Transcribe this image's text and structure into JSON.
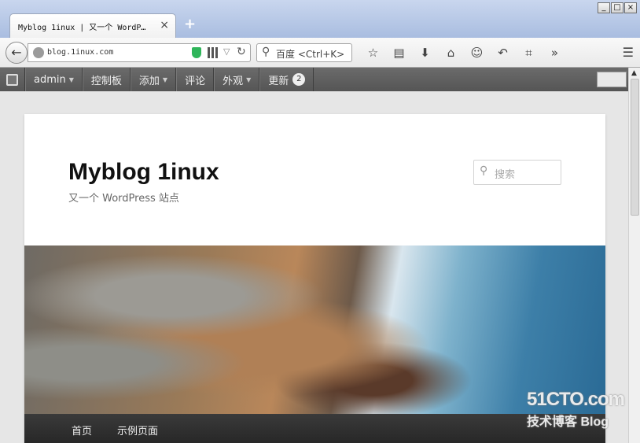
{
  "browser": {
    "window_buttons": [
      "_",
      "□",
      "×"
    ],
    "tab_title": "Myblog 1inux | 又一个 WordP…",
    "tab_close": "×",
    "new_tab": "+",
    "url": "blog.1inux.com",
    "search_placeholder": "百度 <Ctrl+K>",
    "icons": [
      "star-icon",
      "reading-list-icon",
      "download-icon",
      "home-icon",
      "smiley-icon",
      "undo-icon",
      "crop-icon",
      "overflow-icon"
    ]
  },
  "adminbar": {
    "items": [
      {
        "label": "admin",
        "caret": "▼"
      },
      {
        "label": "控制板"
      },
      {
        "label": "添加",
        "caret": "▼"
      },
      {
        "label": "评论"
      },
      {
        "label": "外观",
        "caret": "▼"
      },
      {
        "label": "更新",
        "badge": "2"
      }
    ]
  },
  "site": {
    "title": "Myblog 1inux",
    "description": "又一个 WordPress 站点",
    "search_placeholder": "搜索",
    "nav": [
      "首页",
      "示例页面"
    ]
  },
  "watermark": {
    "line1": "51CTO.com",
    "line2": "技术博客 Blog"
  }
}
